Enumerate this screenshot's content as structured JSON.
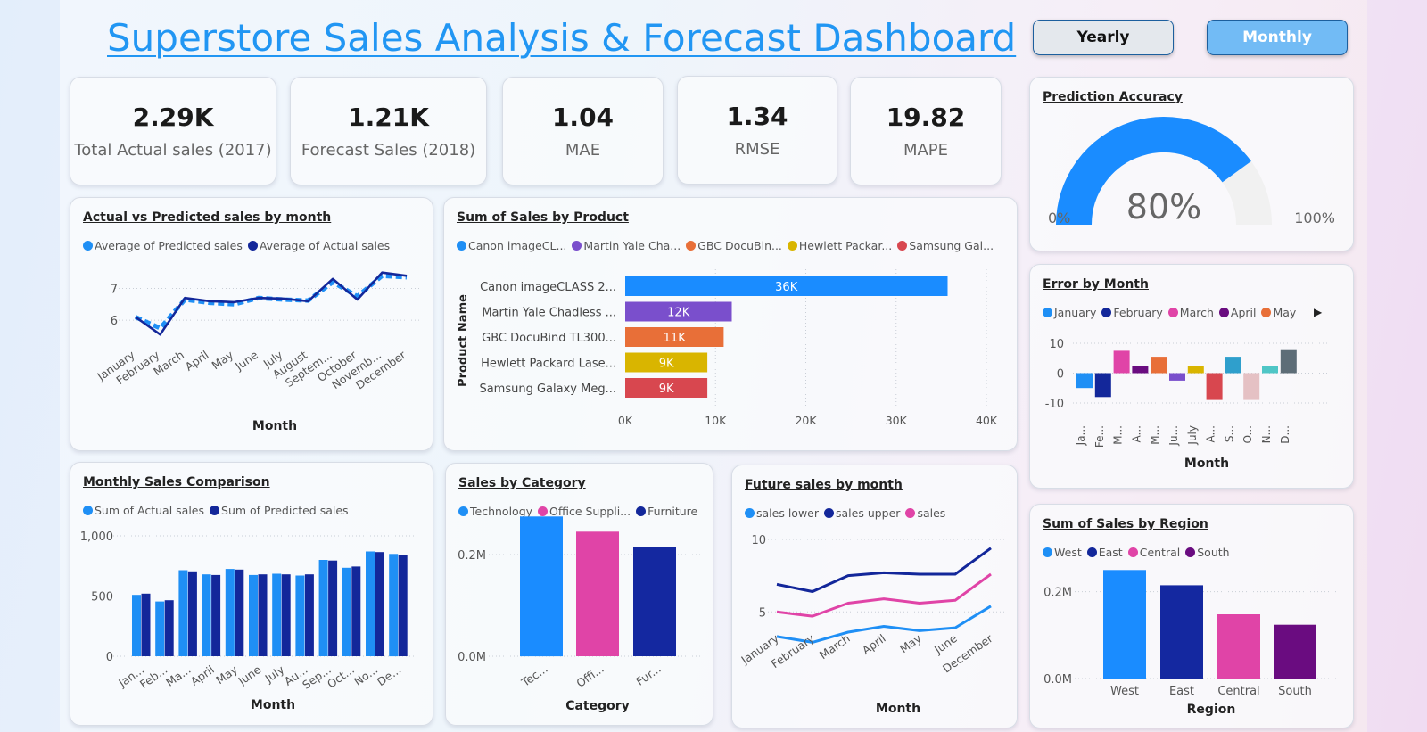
{
  "header": {
    "title": "Superstore Sales Analysis & Forecast Dashboard",
    "yearly_label": "Yearly",
    "monthly_label": "Monthly"
  },
  "kpis": [
    {
      "value": "2.29K",
      "label": "Total Actual sales (2017)"
    },
    {
      "value": "1.21K",
      "label": "Forecast Sales (2018)"
    },
    {
      "value": "1.04",
      "label": "MAE"
    },
    {
      "value": "1.34",
      "label": "RMSE"
    },
    {
      "value": "19.82",
      "label": "MAPE"
    }
  ],
  "gauge": {
    "title": "Prediction Accuracy",
    "value": 80,
    "value_label": "80%",
    "min_label": "0%",
    "max_label": "100%",
    "fill": "#1a8cff",
    "track": "#f1f1f1"
  },
  "avp": {
    "title": "Actual vs Predicted sales by month",
    "xlabel": "Month",
    "legend": [
      {
        "label": "Average of Predicted sales",
        "color": "#1f8ff5"
      },
      {
        "label": "Average of Actual sales",
        "color": "#13279a"
      }
    ],
    "chart_data": {
      "type": "line",
      "x": [
        "January",
        "February",
        "March",
        "April",
        "May",
        "June",
        "July",
        "August",
        "Septem...",
        "October",
        "Novemb...",
        "December"
      ],
      "series": [
        {
          "name": "Average of Predicted sales",
          "values": [
            6.1,
            5.75,
            6.65,
            6.55,
            6.5,
            6.7,
            6.65,
            6.62,
            7.2,
            6.75,
            7.4,
            7.35
          ]
        },
        {
          "name": "Average of Actual sales",
          "values": [
            6.1,
            5.55,
            6.7,
            6.6,
            6.57,
            6.7,
            6.68,
            6.6,
            7.3,
            6.65,
            7.5,
            7.4
          ]
        }
      ],
      "yticks": [
        6,
        7
      ],
      "ylim": [
        5.5,
        7.8
      ]
    }
  },
  "product": {
    "title": "Sum of Sales by Product",
    "ylabel": "Product Name",
    "legend": [
      {
        "label": "Canon imageCL...",
        "color": "#1f8ff5"
      },
      {
        "label": "Martin Yale Cha...",
        "color": "#7a4fcc"
      },
      {
        "label": "GBC DocuBin...",
        "color": "#e86f38"
      },
      {
        "label": "Hewlett Packar...",
        "color": "#d9b500"
      },
      {
        "label": "Samsung Gal...",
        "color": "#d8474f"
      }
    ],
    "chart_data": {
      "type": "bar",
      "orientation": "horizontal",
      "categories": [
        "Canon imageCLASS 2...",
        "Martin Yale Chadless ...",
        "GBC DocuBind TL300...",
        "Hewlett Packard Lase...",
        "Samsung Galaxy Meg..."
      ],
      "values": [
        35700,
        11800,
        10900,
        9100,
        9100
      ],
      "value_labels": [
        "36K",
        "12K",
        "11K",
        "9K",
        "9K"
      ],
      "colors": [
        "#1a8cff",
        "#7a4fcc",
        "#e86f38",
        "#d9b500",
        "#d8474f"
      ],
      "xticks": [
        "0K",
        "10K",
        "20K",
        "30K",
        "40K"
      ],
      "xlim": [
        0,
        40000
      ]
    }
  },
  "error": {
    "title": "Error by Month",
    "xlabel": "Month",
    "legend": [
      {
        "label": "January",
        "color": "#1f8ff5"
      },
      {
        "label": "February",
        "color": "#13279a"
      },
      {
        "label": "March",
        "color": "#e044a7"
      },
      {
        "label": "April",
        "color": "#6a0c80"
      },
      {
        "label": "May",
        "color": "#e86f38"
      }
    ],
    "chart_data": {
      "type": "bar",
      "categories": [
        "Ja...",
        "Fe...",
        "M...",
        "A...",
        "M...",
        "Ju...",
        "July",
        "A...",
        "S...",
        "O...",
        "N...",
        "D..."
      ],
      "values": [
        -5,
        -8,
        7.5,
        2.5,
        5.5,
        -2.5,
        2.5,
        -9,
        5.5,
        -9,
        2.5,
        8
      ],
      "colors": [
        "#1f8ff5",
        "#13279a",
        "#e044a7",
        "#6a0c80",
        "#e86f38",
        "#7a4fcc",
        "#d9b500",
        "#d8474f",
        "#2f9fcc",
        "#e5c1c4",
        "#4fc6c6",
        "#5d6d77"
      ],
      "yticks": [
        10,
        0,
        -10
      ],
      "ylim": [
        -13,
        13
      ]
    }
  },
  "monthly": {
    "title": "Monthly Sales Comparison",
    "xlabel": "Month",
    "legend": [
      {
        "label": "Sum of Actual sales",
        "color": "#1f8ff5"
      },
      {
        "label": "Sum of Predicted sales",
        "color": "#13279a"
      }
    ],
    "chart_data": {
      "type": "bar",
      "categories": [
        "Jan...",
        "Feb...",
        "Ma...",
        "April",
        "May",
        "June",
        "July",
        "Au...",
        "Sep...",
        "Oct...",
        "No...",
        "De..."
      ],
      "series": [
        {
          "name": "Sum of Actual sales",
          "values": [
            510,
            455,
            715,
            680,
            725,
            675,
            685,
            670,
            800,
            735,
            870,
            850
          ]
        },
        {
          "name": "Sum of Predicted sales",
          "values": [
            520,
            465,
            705,
            675,
            720,
            680,
            680,
            680,
            795,
            745,
            865,
            840
          ]
        }
      ],
      "yticks": [
        "0",
        "500",
        "1,000"
      ],
      "ylim": [
        0,
        1000
      ]
    }
  },
  "category": {
    "title": "Sales by Category",
    "xlabel": "Category",
    "legend": [
      {
        "label": "Technology",
        "color": "#1f8ff5"
      },
      {
        "label": "Office Suppli...",
        "color": "#e044a7"
      },
      {
        "label": "Furniture",
        "color": "#13279a"
      }
    ],
    "chart_data": {
      "type": "bar",
      "categories": [
        "Tec...",
        "Offi...",
        "Fur..."
      ],
      "values": [
        0.275,
        0.245,
        0.215
      ],
      "colors": [
        "#1a8cff",
        "#e044a7",
        "#1428a0"
      ],
      "yticks": [
        "0.0M",
        "0.2M"
      ],
      "ylim": [
        0,
        0.3
      ]
    }
  },
  "future": {
    "title": "Future sales by month",
    "xlabel": "Month",
    "legend": [
      {
        "label": "sales lower",
        "color": "#1f8ff5"
      },
      {
        "label": "sales upper",
        "color": "#13279a"
      },
      {
        "label": "sales",
        "color": "#e044a7"
      }
    ],
    "chart_data": {
      "type": "line",
      "x": [
        "January",
        "February",
        "March",
        "April",
        "May",
        "June",
        "December"
      ],
      "series": [
        {
          "name": "sales lower",
          "values": [
            3.3,
            2.9,
            3.6,
            4.0,
            3.7,
            3.9,
            5.4
          ]
        },
        {
          "name": "sales upper",
          "values": [
            6.9,
            6.4,
            7.5,
            7.7,
            7.6,
            7.6,
            9.4
          ]
        },
        {
          "name": "sales",
          "values": [
            5.0,
            4.7,
            5.6,
            5.9,
            5.6,
            5.8,
            7.6
          ]
        }
      ],
      "yticks": [
        5,
        10
      ],
      "ylim": [
        2,
        10
      ]
    }
  },
  "region": {
    "title": "Sum of Sales by Region",
    "xlabel": "Region",
    "legend": [
      {
        "label": "West",
        "color": "#1f8ff5"
      },
      {
        "label": "East",
        "color": "#13279a"
      },
      {
        "label": "Central",
        "color": "#e044a7"
      },
      {
        "label": "South",
        "color": "#6a0c80"
      }
    ],
    "chart_data": {
      "type": "bar",
      "categories": [
        "West",
        "East",
        "Central",
        "South"
      ],
      "values": [
        0.25,
        0.215,
        0.148,
        0.124
      ],
      "colors": [
        "#1a8cff",
        "#1428a0",
        "#e044a7",
        "#6a0c80"
      ],
      "yticks": [
        "0.0M",
        "0.2M"
      ],
      "ylim": [
        0,
        0.3
      ]
    }
  }
}
